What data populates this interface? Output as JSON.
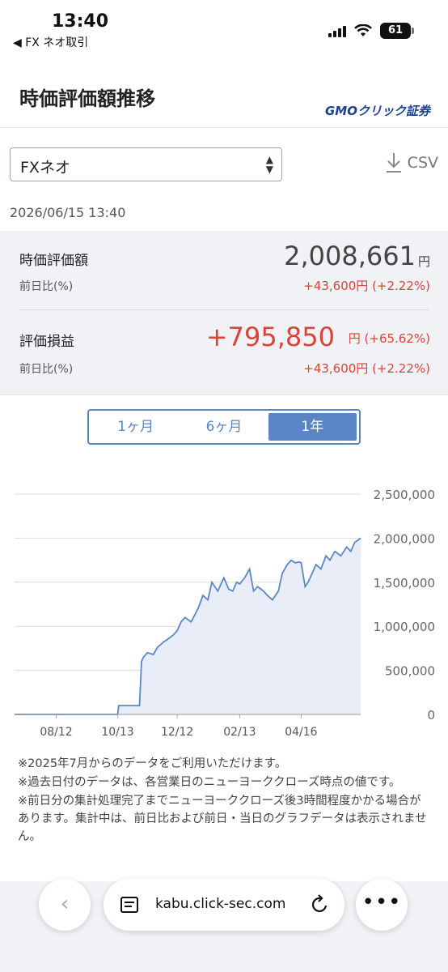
{
  "status": {
    "time": "13:40",
    "back_app": "◀ FX ネオ取引",
    "battery": "61"
  },
  "header": {
    "title": "時価評価額推移",
    "brand": "GMOクリック証券"
  },
  "controls": {
    "product_select": "FXネオ",
    "csv_label": "CSV",
    "timestamp": "2026/06/15 13:40"
  },
  "summary": {
    "valuation": {
      "label": "時価評価額",
      "value": "2,008,661",
      "unit": "円",
      "sub_label": "前日比(%)",
      "change": "+43,600円 (+2.22%)"
    },
    "pnl": {
      "label": "評価損益",
      "value": "+795,850",
      "unit": "円 (+65.62%)",
      "sub_label": "前日比(%)",
      "change": "+43,600円 (+2.22%)"
    },
    "colors": {
      "positive": "#d9443a",
      "neutral": "#444444"
    }
  },
  "tabs": [
    {
      "label": "1ヶ月",
      "active": false
    },
    {
      "label": "6ヶ月",
      "active": false
    },
    {
      "label": "1年",
      "active": true
    }
  ],
  "chart_data": {
    "type": "area",
    "x_ticks": [
      "08/12",
      "10/13",
      "12/12",
      "02/13",
      "04/16"
    ],
    "y_ticks": [
      "2,500,000",
      "2,000,000",
      "1,500,000",
      "1,000,000",
      "500,000",
      "0"
    ],
    "ylim": [
      0,
      2500000
    ],
    "grid": true,
    "color": "#5b86c5",
    "series": [
      {
        "x": [
          "2025-07-01",
          "2025-08-12",
          "2025-10-01",
          "2025-10-13",
          "2025-10-14",
          "2025-11-04",
          "2025-11-06",
          "2025-11-08",
          "2025-11-12",
          "2025-11-18",
          "2025-11-22",
          "2025-11-28",
          "2025-12-02",
          "2025-12-08",
          "2025-12-12",
          "2025-12-16",
          "2025-12-20",
          "2025-12-26",
          "2026-01-02",
          "2026-01-07",
          "2026-01-12",
          "2026-01-16",
          "2026-01-22",
          "2026-01-28",
          "2026-02-02",
          "2026-02-06",
          "2026-02-10",
          "2026-02-13",
          "2026-02-18",
          "2026-02-23",
          "2026-02-27",
          "2026-03-03",
          "2026-03-09",
          "2026-03-13",
          "2026-03-18",
          "2026-03-24",
          "2026-03-28",
          "2026-04-02",
          "2026-04-06",
          "2026-04-10",
          "2026-04-14",
          "2026-04-16",
          "2026-04-20",
          "2026-04-23",
          "2026-04-27",
          "2026-05-01",
          "2026-05-06",
          "2026-05-11",
          "2026-05-15",
          "2026-05-20",
          "2026-05-26",
          "2026-06-01",
          "2026-06-05",
          "2026-06-09",
          "2026-06-15"
        ],
        "y": [
          0,
          0,
          0,
          0,
          100000,
          100000,
          600000,
          650000,
          700000,
          680000,
          760000,
          820000,
          850000,
          900000,
          950000,
          1050000,
          1100000,
          1050000,
          1200000,
          1350000,
          1300000,
          1500000,
          1400000,
          1550000,
          1420000,
          1400000,
          1500000,
          1480000,
          1550000,
          1650000,
          1400000,
          1450000,
          1400000,
          1350000,
          1300000,
          1400000,
          1600000,
          1700000,
          1750000,
          1720000,
          1730000,
          1720000,
          1450000,
          1500000,
          1600000,
          1700000,
          1650000,
          1800000,
          1750000,
          1850000,
          1800000,
          1900000,
          1850000,
          1950000,
          2000000
        ]
      }
    ]
  },
  "notes": [
    "※2025年7月からのデータをご利用いただけます。",
    "※過去日付のデータは、各営業日のニューヨーククローズ時点の値です。",
    "※前日分の集計処理完了までニューヨーククローズ後3時間程度かかる場合があります。集計中は、前日比および前日・当日のグラフデータは表示されません。"
  ],
  "browser": {
    "url": "kabu.click-sec.com",
    "back_glyph": "‹",
    "more_glyph": "•••"
  }
}
